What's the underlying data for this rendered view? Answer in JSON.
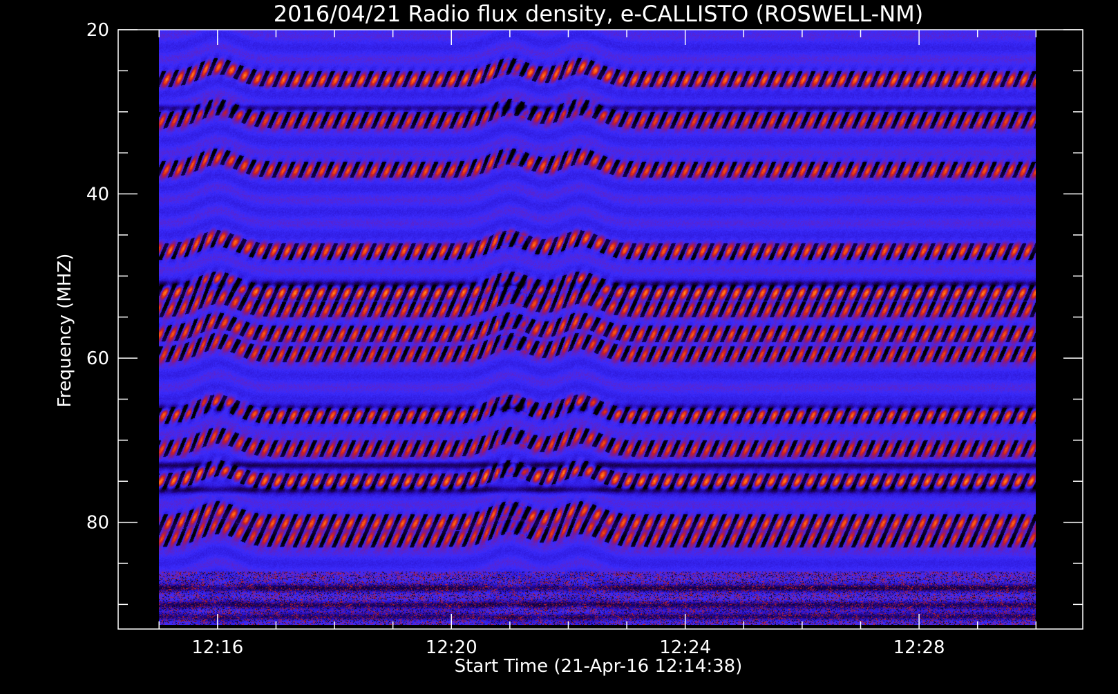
{
  "chart_data": {
    "type": "heatmap",
    "title": "2016/04/21  Radio flux density, e-CALLISTO (ROSWELL-NM)",
    "xlabel": "Start Time (21-Apr-16 12:14:38)",
    "ylabel": "Frequency (MHZ)",
    "x_ticks": [
      {
        "label": "12:16",
        "minutes": 16
      },
      {
        "label": "12:20",
        "minutes": 20
      },
      {
        "label": "12:24",
        "minutes": 24
      },
      {
        "label": "12:28",
        "minutes": 28
      }
    ],
    "x_minor_ticks_minutes": [
      15,
      17,
      18,
      19,
      21,
      22,
      23,
      25,
      26,
      27,
      29,
      30
    ],
    "y_ticks": [
      20,
      40,
      60,
      80
    ],
    "y_minor_tick_step": 5,
    "xlim_minutes": [
      14.3,
      30.8
    ],
    "ylim": [
      20,
      93
    ],
    "data_extent": {
      "time_minutes": [
        15.0,
        30.0
      ],
      "freq_mhz": [
        20,
        92.5
      ]
    },
    "colormap": [
      "#000000",
      "#1a0060",
      "#2a10c8",
      "#3a2cff",
      "#7a1a9a",
      "#c81e1e",
      "#ff5a10",
      "#ffd040"
    ],
    "bright_bands_mhz": [
      26,
      31,
      37,
      47,
      52,
      54,
      57,
      59.5,
      67,
      71,
      75,
      80,
      82
    ],
    "dark_bands_mhz": [
      29.5,
      51,
      66,
      73,
      76,
      88,
      90,
      91.5
    ],
    "dip_times_minutes": [
      16.0,
      21.0,
      22.2
    ],
    "grid": false,
    "legend": "none"
  }
}
